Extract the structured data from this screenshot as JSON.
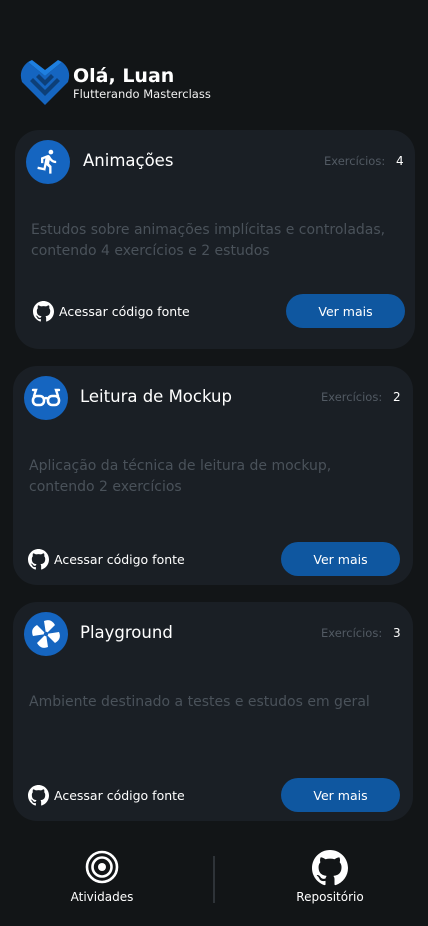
{
  "header": {
    "greeting": "Olá, Luan",
    "subtitle": "Flutterando Masterclass",
    "logo_icon": "flutterando-heart-logo"
  },
  "colors": {
    "background": "#121517",
    "card": "#1a1f25",
    "accent": "#1565c0",
    "button": "#0f57a0",
    "muted_text": "#4a525a"
  },
  "cards": [
    {
      "icon": "running-person-icon",
      "title": "Animações",
      "exercises_label": "Exercícios:",
      "exercises_count": "4",
      "description": "Estudos sobre animações implícitas e controladas, contendo 4 exercícios  e 2 estudos",
      "source_label": "Acessar código fonte",
      "button_label": "Ver mais"
    },
    {
      "icon": "glasses-icon",
      "title": "Leitura de Mockup",
      "exercises_label": "Exercícios:",
      "exercises_count": "2",
      "description": "Aplicação da técnica de leitura de mockup, contendo 2 exercícios",
      "source_label": "Acessar código fonte",
      "button_label": "Ver mais"
    },
    {
      "icon": "pinwheel-icon",
      "title": "Playground",
      "exercises_label": "Exercícios:",
      "exercises_count": "3",
      "description": "Ambiente destinado a testes e estudos em geral",
      "source_label": "Acessar código fonte",
      "button_label": "Ver mais"
    }
  ],
  "bottom_nav": {
    "items": [
      {
        "label": "Atividades",
        "icon": "target-icon"
      },
      {
        "label": "Repositório",
        "icon": "github-icon"
      }
    ]
  }
}
